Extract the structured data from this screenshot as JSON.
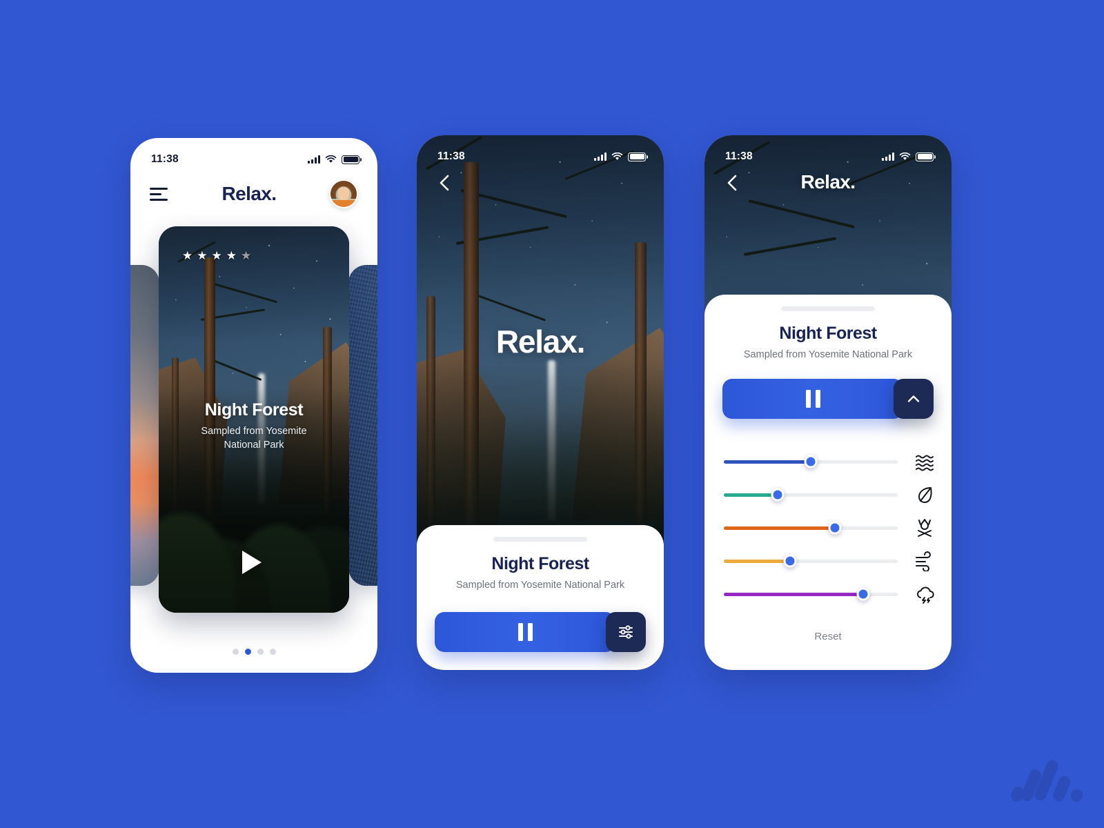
{
  "app": {
    "brand": "Relax.",
    "accent": "#2f58d6",
    "dark_navy": "#182352",
    "background": "#3257d2"
  },
  "status_bar": {
    "time": "11:38",
    "signal_icon": "cellular-signal-icon",
    "wifi_icon": "wifi-icon",
    "battery_icon": "battery-icon"
  },
  "screen_home": {
    "menu_icon": "hamburger-menu-icon",
    "title": "Relax.",
    "avatar_label": "user-avatar",
    "card": {
      "rating": 4,
      "rating_max": 5,
      "title": "Night Forest",
      "subtitle_line1": "Sampled from Yosemite",
      "subtitle_line2": "National Park",
      "play_icon": "play-icon"
    },
    "pagination": {
      "count": 4,
      "active_index": 1
    }
  },
  "screen_player": {
    "back_icon": "chevron-left-icon",
    "hero_title": "Relax.",
    "sheet": {
      "title": "Night Forest",
      "subtitle": "Sampled from Yosemite National Park",
      "play_icon": "pause-icon",
      "mixer_icon": "sliders-icon"
    }
  },
  "screen_mixer": {
    "back_icon": "chevron-left-icon",
    "title": "Relax.",
    "sheet": {
      "title": "Night Forest",
      "subtitle": "Sampled from Yosemite National Park",
      "play_icon": "pause-icon",
      "collapse_icon": "chevron-up-icon"
    },
    "sliders": [
      {
        "name": "waves",
        "icon": "waves-icon",
        "value": 50,
        "color": "#2f52bd"
      },
      {
        "name": "leaves",
        "icon": "leaf-icon",
        "value": 31,
        "color": "#25ab90"
      },
      {
        "name": "fire",
        "icon": "campfire-icon",
        "value": 64,
        "color": "#e0661e"
      },
      {
        "name": "wind",
        "icon": "wind-icon",
        "value": 38,
        "color": "#edab3b"
      },
      {
        "name": "storm",
        "icon": "storm-cloud-icon",
        "value": 80,
        "color": "#9627c2"
      }
    ],
    "reset_label": "Reset"
  },
  "watermark": {
    "name": "brand-watermark-logo"
  }
}
